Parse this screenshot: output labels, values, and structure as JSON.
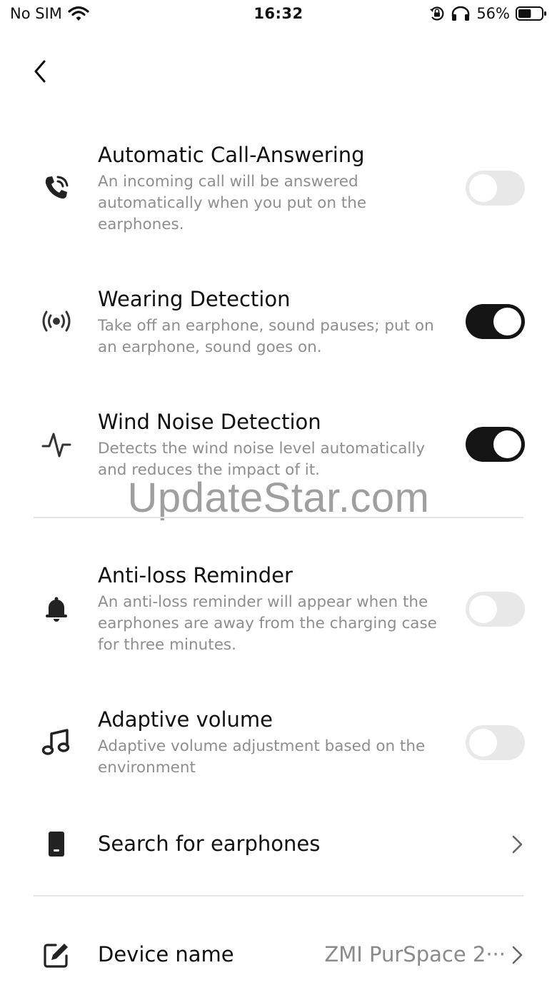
{
  "status_bar": {
    "carrier": "No SIM",
    "time": "16:32",
    "battery_percent": "56%",
    "battery_level": 0.56,
    "icons": [
      "wifi-icon",
      "orientation-lock-icon",
      "headphones-icon",
      "battery-icon"
    ]
  },
  "nav": {
    "back_icon": "chevron-left-icon"
  },
  "settings": [
    {
      "icon": "phone-call-icon",
      "title": "Automatic Call-Answering",
      "description": "An incoming call will be answered automatically when you put on the earphones.",
      "enabled": false
    },
    {
      "icon": "wireless-signal-icon",
      "title": "Wearing Detection",
      "description": "Take off an earphone, sound pauses; put on an earphone, sound goes on.",
      "enabled": true
    },
    {
      "icon": "activity-wave-icon",
      "title": "Wind Noise Detection",
      "description": "Detects the wind noise level automatically and reduces the impact of it.",
      "enabled": true
    },
    {
      "icon": "bell-icon",
      "title": "Anti-loss Reminder",
      "description": "An anti-loss reminder will appear when the earphones are away from the charging case for three minutes.",
      "enabled": false
    },
    {
      "icon": "music-note-icon",
      "title": "Adaptive volume",
      "description": "Adaptive volume adjustment based on the environment",
      "enabled": false
    }
  ],
  "search_earphones": {
    "icon": "earphone-case-icon",
    "label": "Search for earphones"
  },
  "device_name": {
    "icon": "edit-icon",
    "label": "Device name",
    "value": "ZMI PurSpace 2···"
  },
  "watermark": "UpdateStar.com",
  "colors": {
    "toggle_on": "#141414",
    "toggle_off": "#e8e8e8",
    "secondary_text": "#8e8e8e"
  }
}
